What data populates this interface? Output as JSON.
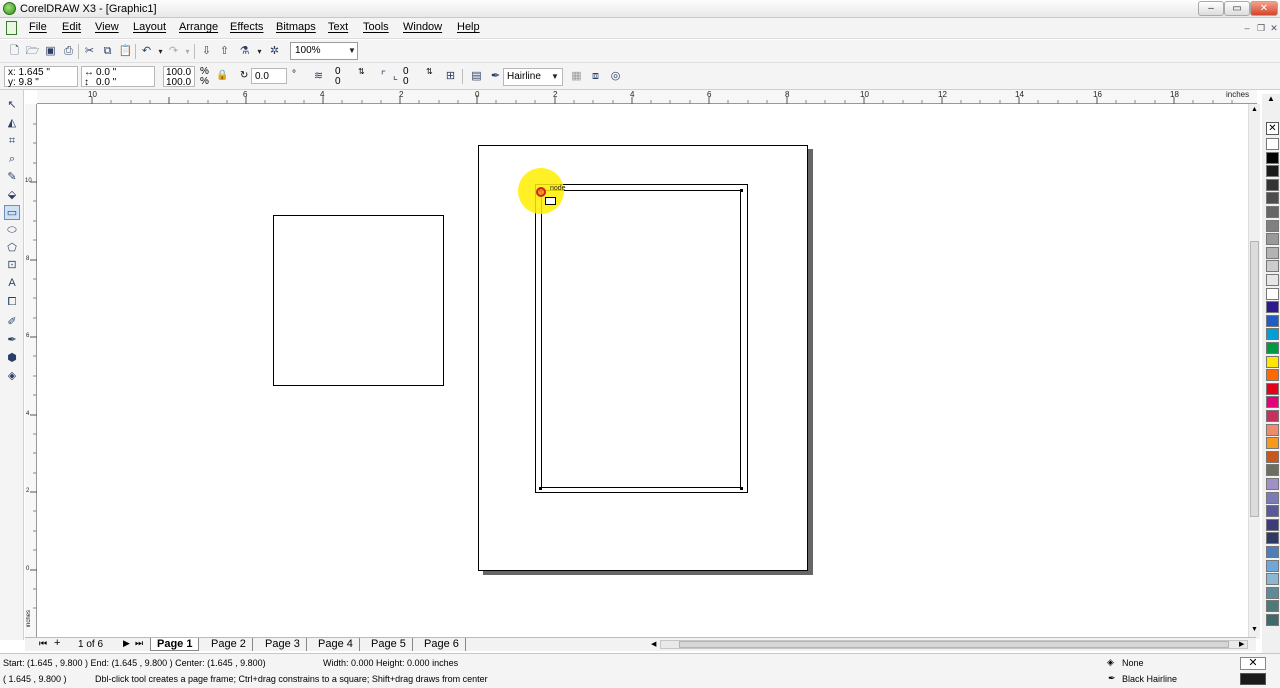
{
  "window": {
    "title": "CorelDRAW X3 - [Graphic1]",
    "minimize": "‒",
    "maximize": "▭",
    "close": "✕"
  },
  "menu": [
    {
      "label": "File"
    },
    {
      "label": "Edit"
    },
    {
      "label": "View"
    },
    {
      "label": "Layout"
    },
    {
      "label": "Arrange"
    },
    {
      "label": "Effects"
    },
    {
      "label": "Bitmaps"
    },
    {
      "label": "Text"
    },
    {
      "label": "Tools"
    },
    {
      "label": "Window"
    },
    {
      "label": "Help"
    }
  ],
  "toolbar": {
    "zoom": "100%"
  },
  "properties": {
    "x": "x: 1.645 \"",
    "y": "y: 9.8 \"",
    "w": "0.0 \"",
    "h": "0.0 \"",
    "scale_x": "100.0",
    "scale_y": "100.0",
    "pct": "%",
    "rotation": "0.0",
    "deg": "°",
    "corner1": "0",
    "corner2": "0",
    "corner3": "0",
    "corner4": "0",
    "outline": "Hairline"
  },
  "ruler": {
    "unit": "inches",
    "h_ticks": [
      "10",
      "6",
      "4",
      "2",
      "0",
      "2",
      "4",
      "6",
      "8",
      "10",
      "12",
      "14",
      "16",
      "18"
    ],
    "v_ticks": [
      "10",
      "8",
      "6",
      "4",
      "2",
      "0"
    ]
  },
  "canvas": {
    "node_label": "node"
  },
  "pages": {
    "counter": "1 of 6",
    "tabs": [
      {
        "label": "Page 1"
      },
      {
        "label": "Page 2"
      },
      {
        "label": "Page 3"
      },
      {
        "label": "Page 4"
      },
      {
        "label": "Page 5"
      },
      {
        "label": "Page 6"
      }
    ]
  },
  "status": {
    "line1": "Start: (1.645 , 9.800 )  End: (1.645 , 9.800 )  Center: (1.645 , 9.800)",
    "dims": "Width: 0.000  Height: 0.000  inches",
    "coords": "( 1.645 , 9.800 )",
    "hint": "Dbl-click tool creates a page frame; Ctrl+drag constrains to a square; Shift+drag draws from center",
    "fill": "None",
    "outline": "Black  Hairline"
  },
  "palette": [
    "#ffffff",
    "#000000",
    "#1a1a1a",
    "#333333",
    "#4d4d4d",
    "#666666",
    "#808080",
    "#999999",
    "#b3b3b3",
    "#cccccc",
    "#e6e6e6",
    "#ffffff",
    "#2e1a8c",
    "#1f5cc4",
    "#00a0d6",
    "#009a44",
    "#ffe600",
    "#ff6a00",
    "#e2001a",
    "#e4007c",
    "#c7315e",
    "#f08a6c",
    "#f39a1f",
    "#c9561c",
    "#6e6e5e",
    "#a090c8",
    "#7b7bb8",
    "#5a5a9a",
    "#3c3c7a",
    "#2e3a66",
    "#4f7fb8",
    "#6fa8d8",
    "#8ab8d0",
    "#5e8a9a",
    "#4e7a7a",
    "#3e6a6a"
  ]
}
